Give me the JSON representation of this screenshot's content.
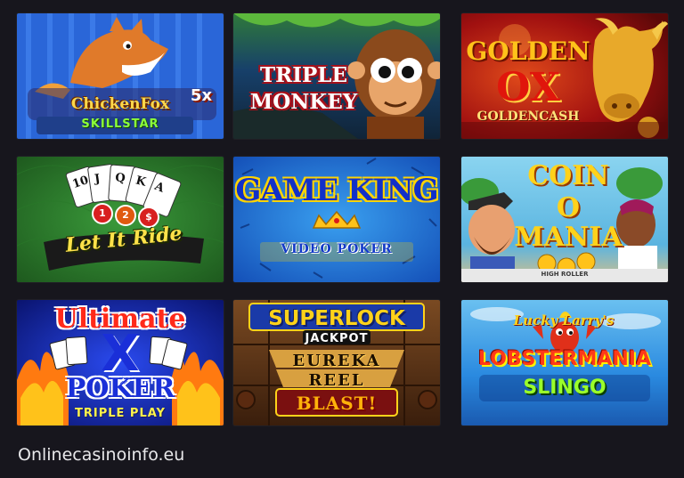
{
  "tiles": [
    {
      "id": "chicken-fox",
      "lines": [
        "ChickenFox",
        "SKILLSTAR",
        "5x"
      ],
      "bg": "#2a66d8"
    },
    {
      "id": "triple-monkey",
      "lines": [
        "TRIPLE",
        "MONKEY"
      ],
      "bg": "#1e3a2a"
    },
    {
      "id": "golden-ox",
      "lines": [
        "GOLDEN",
        "OX",
        "GOLDENCASH"
      ],
      "bg": "#a01010"
    },
    {
      "id": "let-it-ride",
      "lines": [
        "Let It Ride",
        "1",
        "2",
        "$"
      ],
      "bg": "#2d7a2a"
    },
    {
      "id": "game-king",
      "lines": [
        "GAME KING",
        "VIDEO POKER"
      ],
      "bg": "#1a66d0"
    },
    {
      "id": "coin-o-mania",
      "lines": [
        "COIN",
        "O",
        "MANIA",
        "HIGH ROLLER"
      ],
      "bg": "#78c8e8"
    },
    {
      "id": "ultimate-x-poker",
      "lines": [
        "Ultimate",
        "X",
        "POKER",
        "TRIPLE PLAY"
      ],
      "bg": "#1a2fd8"
    },
    {
      "id": "superlock-jackpot",
      "lines": [
        "SUPERLOCK",
        "JACKPOT",
        "EUREKA",
        "REEL",
        "BLAST!"
      ],
      "bg": "#5a3218"
    },
    {
      "id": "lobstermania-slingo",
      "lines": [
        "Lucky Larry's",
        "LOBSTERMANIA",
        "SLINGO"
      ],
      "bg": "#2a8ae0"
    }
  ],
  "footer": {
    "site": "Onlinecasinoinfo.eu"
  }
}
